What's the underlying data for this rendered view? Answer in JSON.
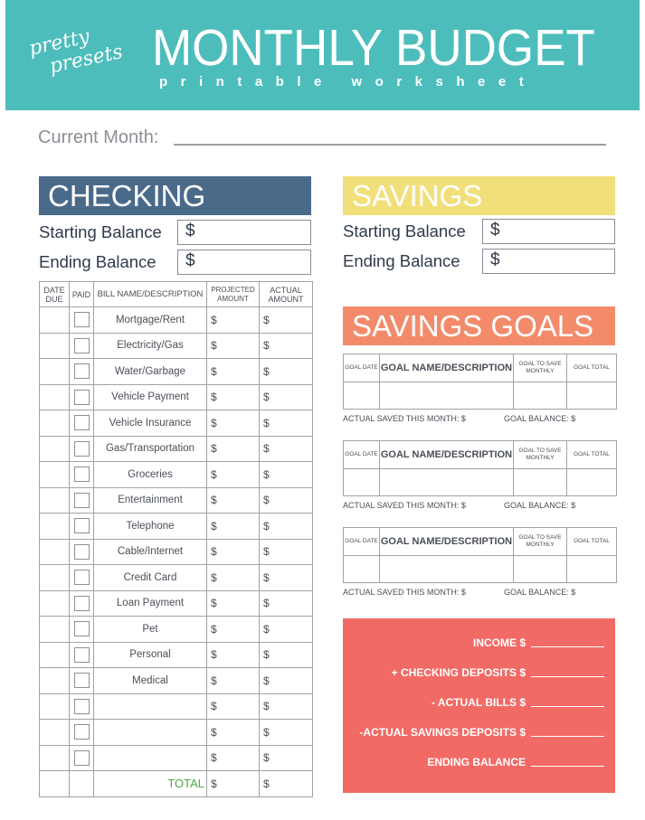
{
  "header": {
    "logo_line1": "pretty",
    "logo_line2": "presets",
    "title": "MONTHLY BUDGET",
    "subtitle": "printable worksheet",
    "bg_color": "#4dbdbc"
  },
  "current_month": {
    "label": "Current Month:",
    "value": ""
  },
  "checking": {
    "title": "CHECKING",
    "color": "#4a6a8a",
    "starting_balance_label": "Starting Balance",
    "ending_balance_label": "Ending Balance",
    "starting_balance_value": "$",
    "ending_balance_value": "$",
    "table": {
      "columns": [
        "DATE DUE",
        "PAID",
        "BILL NAME/DESCRIPTION",
        "PROJECTED AMOUNT",
        "ACTUAL AMOUNT"
      ],
      "rows": [
        {
          "name": "Mortgage/Rent",
          "projected": "$",
          "actual": "$"
        },
        {
          "name": "Electricity/Gas",
          "projected": "$",
          "actual": "$"
        },
        {
          "name": "Water/Garbage",
          "projected": "$",
          "actual": "$"
        },
        {
          "name": "Vehicle Payment",
          "projected": "$",
          "actual": "$"
        },
        {
          "name": "Vehicle Insurance",
          "projected": "$",
          "actual": "$"
        },
        {
          "name": "Gas/Transportation",
          "projected": "$",
          "actual": "$"
        },
        {
          "name": "Groceries",
          "projected": "$",
          "actual": "$"
        },
        {
          "name": "Entertainment",
          "projected": "$",
          "actual": "$"
        },
        {
          "name": "Telephone",
          "projected": "$",
          "actual": "$"
        },
        {
          "name": "Cable/Internet",
          "projected": "$",
          "actual": "$"
        },
        {
          "name": "Credit Card",
          "projected": "$",
          "actual": "$"
        },
        {
          "name": "Loan Payment",
          "projected": "$",
          "actual": "$"
        },
        {
          "name": "Pet",
          "projected": "$",
          "actual": "$"
        },
        {
          "name": "Personal",
          "projected": "$",
          "actual": "$"
        },
        {
          "name": "Medical",
          "projected": "$",
          "actual": "$"
        },
        {
          "name": "",
          "projected": "$",
          "actual": "$"
        },
        {
          "name": "",
          "projected": "$",
          "actual": "$"
        },
        {
          "name": "",
          "projected": "$",
          "actual": "$"
        }
      ],
      "total_label": "TOTAL",
      "total_projected": "$",
      "total_actual": "$",
      "total_color": "#4aaa4a"
    }
  },
  "savings": {
    "title": "SAVINGS",
    "color": "#f1df7a",
    "starting_balance_label": "Starting Balance",
    "ending_balance_label": "Ending Balance",
    "starting_balance_value": "$",
    "ending_balance_value": "$"
  },
  "savings_goals": {
    "title": "SAVINGS GOALS",
    "color": "#f38b6b",
    "columns": [
      "GOAL DATE",
      "GOAL NAME/DESCRIPTION",
      "GOAL TO SAVE MONTHLY",
      "GOAL TOTAL"
    ],
    "actual_saved_label": "ACTUAL SAVED THIS MONTH: $",
    "goal_balance_label": "GOAL BALANCE: $",
    "goals": [
      {},
      {},
      {}
    ]
  },
  "summary": {
    "color": "#f26a65",
    "rows": [
      {
        "label": "INCOME $"
      },
      {
        "label": "+ CHECKING DEPOSITS $"
      },
      {
        "label": "- ACTUAL BILLS $"
      },
      {
        "label": "-ACTUAL SAVINGS DEPOSITS $"
      },
      {
        "label": "ENDING BALANCE"
      }
    ]
  }
}
